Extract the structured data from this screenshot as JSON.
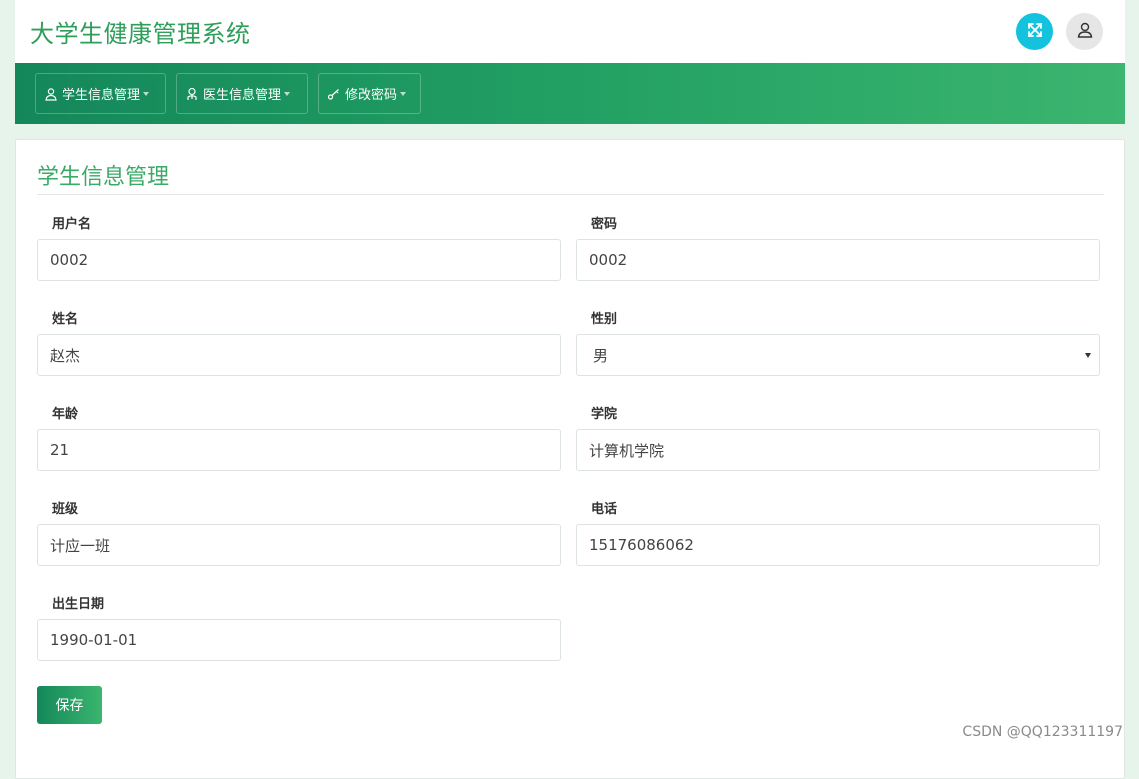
{
  "app": {
    "title": "大学生健康管理系统"
  },
  "header": {
    "fullscreen_icon": "expand-arrows-icon",
    "user_icon": "user-icon"
  },
  "nav": {
    "items": [
      {
        "label": "学生信息管理",
        "icon": "user-icon"
      },
      {
        "label": "医生信息管理",
        "icon": "doctor-icon"
      },
      {
        "label": "修改密码",
        "icon": "key-icon"
      }
    ]
  },
  "colors": {
    "brand_green": "#2e9e5a",
    "nav_gradient_start": "#14875a",
    "nav_gradient_end": "#3bb56f",
    "fullscreen_button": "#13c2dc"
  },
  "form": {
    "title": "学生信息管理",
    "fields": {
      "username": {
        "label": "用户名",
        "value": "0002"
      },
      "password": {
        "label": "密码",
        "value": "0002"
      },
      "name": {
        "label": "姓名",
        "value": "赵杰"
      },
      "gender": {
        "label": "性别",
        "value": "男"
      },
      "age": {
        "label": "年龄",
        "value": "21"
      },
      "college": {
        "label": "学院",
        "value": "计算机学院"
      },
      "class": {
        "label": "班级",
        "value": "计应一班"
      },
      "phone": {
        "label": "电话",
        "value": "15176086062"
      },
      "birthdate": {
        "label": "出生日期",
        "value": "1990-01-01"
      }
    },
    "save_label": "保存"
  },
  "watermark": "CSDN @QQ123311197"
}
